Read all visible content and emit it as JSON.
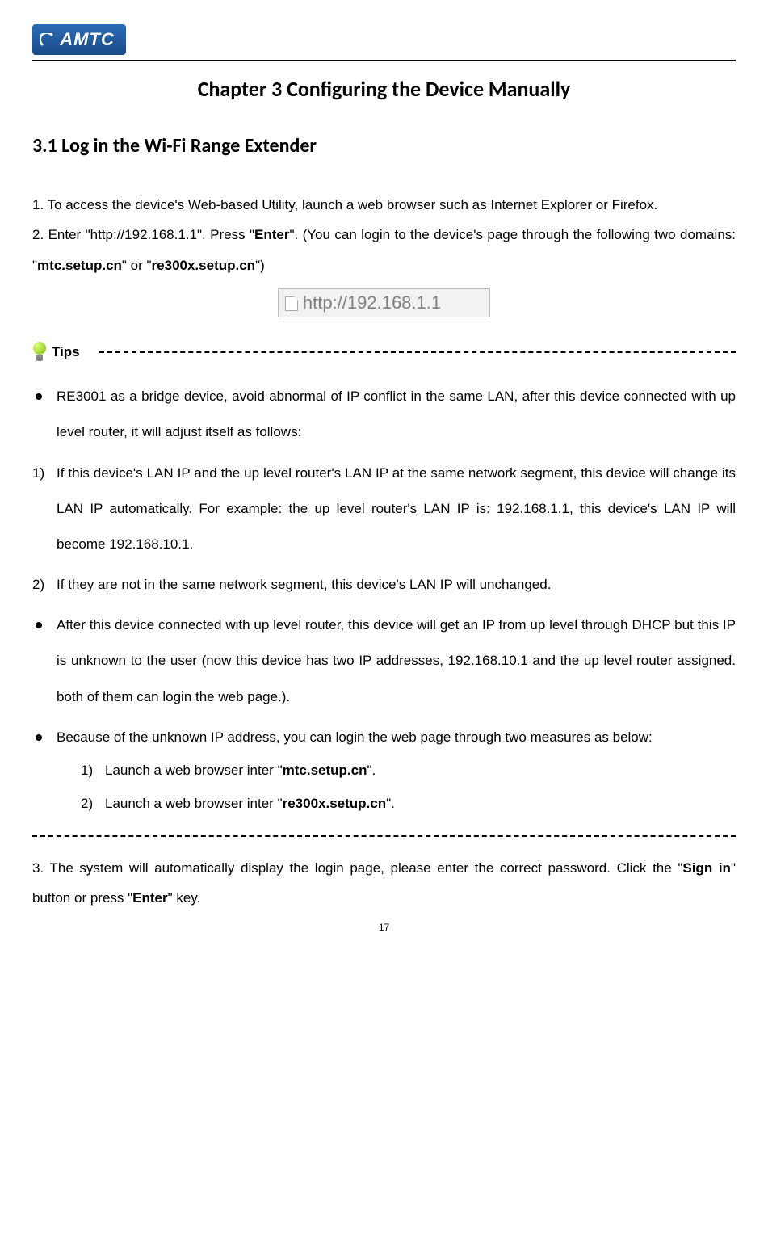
{
  "header": {
    "logo_text": "AMTC"
  },
  "chapter_title": "Chapter 3 Configuring the Device Manually",
  "section_title": "3.1 Log in the Wi-Fi Range Extender",
  "p1_a": "1. To access the device's Web-based Utility, launch a web browser such as Internet Explorer or Firefox.",
  "p2_prefix": "2. Enter \"http://192.168.1.1\". Press \"",
  "p2_enter": "Enter",
  "p2_mid": "\". (You can login to the device's page through the following two domains: \"",
  "p2_d1": "mtc.setup.cn",
  "p2_mid2": "\" or \"",
  "p2_d2": "re300x.setup.cn",
  "p2_suffix": "\")",
  "url_box_text": "http://192.168.1.1",
  "tips_label": "Tips",
  "bul1": "RE3001 as a bridge device, avoid abnormal of IP conflict in the same LAN, after this device connected with up level router, it will adjust itself as follows:",
  "num1_label": "1)",
  "num1_text": "If this device's LAN IP and the up level router's LAN IP at the same network segment, this device will change its LAN IP automatically. For example: the up level router's LAN IP is: 192.168.1.1, this device's LAN IP will become 192.168.10.1.",
  "num2_label": "2)",
  "num2_text": "If they are not in the same network segment, this device's LAN IP will unchanged.",
  "bul2": "After this device connected with up level router, this device will get an IP from up level through DHCP but this IP is unknown to the user (now this device has two IP addresses, 192.168.10.1 and the up level router assigned. both of them can login the web page.).",
  "bul3": "Because of the unknown IP address, you can login the web page through two measures as below:",
  "sub1_label": "1)",
  "sub1_pre": "Launch a web browser inter \"",
  "sub1_b": "mtc.setup.cn",
  "sub1_post": "\".",
  "sub2_label": "2)",
  "sub2_pre": "Launch a web browser inter \"",
  "sub2_b": "re300x.setup.cn",
  "sub2_post": "\".",
  "p3_pre": "3. The system will automatically display the login page, please enter the correct password. Click the \"",
  "p3_b1": "Sign in",
  "p3_mid": "\" button or press \"",
  "p3_b2": "Enter",
  "p3_post": "\" key.",
  "page_number": "17"
}
